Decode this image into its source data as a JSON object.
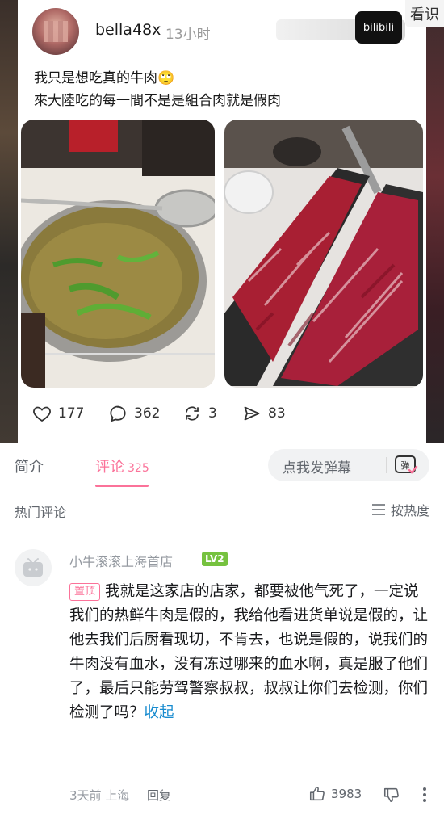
{
  "post": {
    "username": "bella48x",
    "time": "13小时",
    "corner_tag": "看识",
    "watermark": "bilibili",
    "line1": "我只是想吃真的牛肉🙄",
    "line2": "來大陸吃的每一間不是是組合肉就是假肉",
    "stats": {
      "likes": "177",
      "comments": "362",
      "reposts": "3",
      "shares": "83"
    }
  },
  "tabs": {
    "intro": "简介",
    "comments": "评论",
    "comments_count": "325"
  },
  "danmaku": {
    "placeholder": "点我发弹幕",
    "toggle_label": "弹"
  },
  "comments_header": {
    "title": "热门评论",
    "sort": "按热度"
  },
  "comment": {
    "author": "小牛滚滚上海首店",
    "level": "LV2",
    "pinned": "置顶",
    "text": "我就是这家店的店家，都要被他气死了，一定说我们的热鲜牛肉是假的，我给他看进货单说是假的，让他去我们后厨看现切，不肯去，也说是假的，说我们的牛肉没有血水，没有冻过哪来的血水啊，真是服了他们了，最后只能劳驾警察叔叔，叔叔让你们去检测，你们检测了吗？",
    "collapse": "收起",
    "time": "3天前",
    "location": "上海",
    "reply": "回复",
    "likes": "3983"
  },
  "colors": {
    "accent": "#fb7299",
    "link": "#178bcf",
    "level": "#76c23f"
  }
}
